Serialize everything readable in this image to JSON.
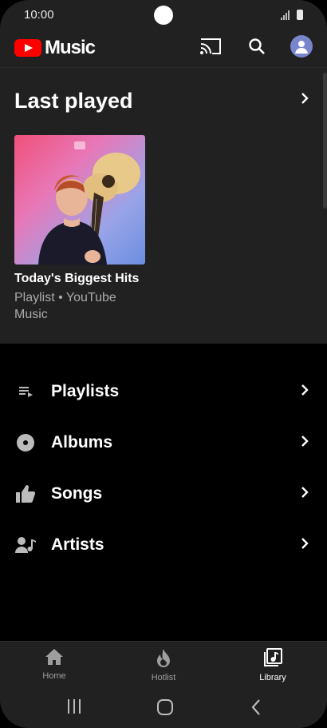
{
  "status_bar": {
    "time": "10:00"
  },
  "app": {
    "logo_text": "Music",
    "brand_color": "#ff0000"
  },
  "app_bar": {
    "icons": [
      "cast-icon",
      "search-icon",
      "account-avatar"
    ]
  },
  "last_played": {
    "title": "Last played",
    "card": {
      "title": "Today's Biggest Hits",
      "subtitle_line1": "Playlist • YouTube",
      "subtitle_line2": "Music"
    }
  },
  "library": {
    "items": [
      {
        "label": "Playlists",
        "icon": "playlist-icon"
      },
      {
        "label": "Albums",
        "icon": "album-icon"
      },
      {
        "label": "Songs",
        "icon": "thumbs-up-icon"
      },
      {
        "label": "Artists",
        "icon": "artist-icon"
      }
    ]
  },
  "bottom_nav": {
    "items": [
      {
        "label": "Home",
        "icon": "home-icon",
        "active": false
      },
      {
        "label": "Hotlist",
        "icon": "flame-icon",
        "active": false
      },
      {
        "label": "Library",
        "icon": "library-icon",
        "active": true
      }
    ]
  },
  "colors": {
    "surface": "#212121",
    "background": "#000000",
    "inactive": "#9e9e9e",
    "active": "#ffffff"
  }
}
